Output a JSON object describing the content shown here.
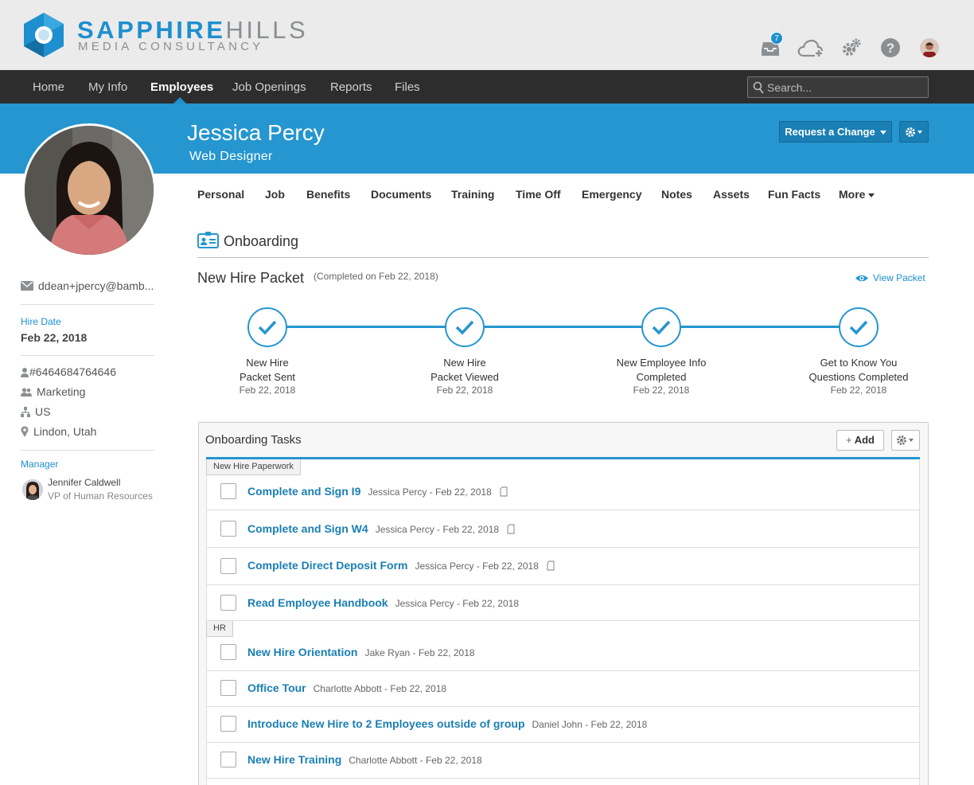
{
  "brand": {
    "name_bold": "SAPPHIRE",
    "name_light": "HILLS",
    "tagline": "MEDIA CONSULTANCY",
    "accent": "#1e8fcf"
  },
  "header_icons": {
    "inbox_badge": "7",
    "icons": [
      "inbox-icon",
      "cloud-upload-icon",
      "settings-gears-icon",
      "help-icon",
      "user-avatar"
    ]
  },
  "nav": {
    "items": [
      "Home",
      "My Info",
      "Employees",
      "Job Openings",
      "Reports",
      "Files"
    ],
    "active": "Employees",
    "search_placeholder": "Search..."
  },
  "employee": {
    "name": "Jessica Percy",
    "title": "Web Designer",
    "request_change_label": "Request a Change",
    "email": "ddean+jpercy@bamb...",
    "hire_date_label": "Hire Date",
    "hire_date": "Feb 22, 2018",
    "employee_number": "#6464684764646",
    "department": "Marketing",
    "location_country": "US",
    "location_city": "Lindon, Utah",
    "manager_label": "Manager",
    "manager_name": "Jennifer Caldwell",
    "manager_title": "VP of Human Resources"
  },
  "subtabs": [
    "Personal",
    "Job",
    "Benefits",
    "Documents",
    "Training",
    "Time Off",
    "Emergency",
    "Notes",
    "Assets",
    "Fun Facts",
    "More"
  ],
  "onboarding": {
    "section_title": "Onboarding",
    "packet_title": "New Hire Packet",
    "packet_status": "(Completed on Feb 22, 2018)",
    "view_packet_label": "View Packet",
    "steps": [
      {
        "line1": "New Hire",
        "line2": "Packet Sent",
        "date": "Feb 22, 2018"
      },
      {
        "line1": "New Hire",
        "line2": "Packet Viewed",
        "date": "Feb 22, 2018"
      },
      {
        "line1": "New Employee Info",
        "line2": "Completed",
        "date": "Feb 22, 2018"
      },
      {
        "line1": "Get to Know You",
        "line2": "Questions Completed",
        "date": "Feb 22, 2018"
      }
    ]
  },
  "tasks": {
    "title": "Onboarding Tasks",
    "add_label": "Add",
    "groups": [
      {
        "name": "New Hire Paperwork",
        "items": [
          {
            "name": "Complete and Sign I9",
            "meta": "Jessica Percy - Feb 22, 2018",
            "has_doc": true
          },
          {
            "name": "Complete and Sign W4",
            "meta": "Jessica Percy - Feb 22, 2018",
            "has_doc": true
          },
          {
            "name": "Complete Direct Deposit Form",
            "meta": "Jessica Percy - Feb 22, 2018",
            "has_doc": true
          },
          {
            "name": "Read Employee Handbook",
            "meta": "Jessica Percy - Feb 22, 2018",
            "has_doc": false
          }
        ]
      },
      {
        "name": "HR",
        "items": [
          {
            "name": "New Hire Orientation",
            "meta": "Jake Ryan - Feb 22, 2018",
            "has_doc": false
          },
          {
            "name": "Office Tour",
            "meta": "Charlotte Abbott - Feb 22, 2018",
            "has_doc": false
          },
          {
            "name": "Introduce New Hire to 2 Employees outside of group",
            "meta": "Daniel John - Feb 22, 2018",
            "has_doc": false
          },
          {
            "name": "New Hire Training",
            "meta": "Charlotte Abbott - Feb 22, 2018",
            "has_doc": false
          }
        ]
      }
    ]
  }
}
